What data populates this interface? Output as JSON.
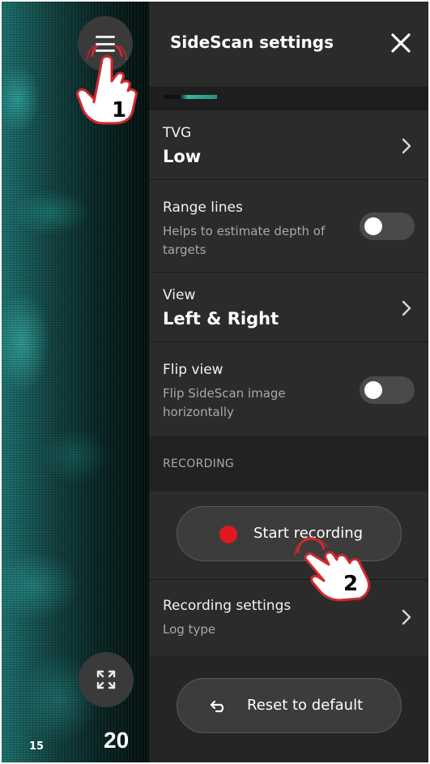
{
  "map": {
    "menu_icon": "hamburger-menu-icon",
    "expand_icon": "expand-arrows-icon",
    "scale_small": "15",
    "scale_large": "20"
  },
  "annotations": {
    "step1": "1",
    "step2": "2"
  },
  "panel": {
    "title": "SideScan settings",
    "close_icon": "close-x-icon",
    "tvg": {
      "label": "TVG",
      "value": "Low"
    },
    "range_lines": {
      "label": "Range lines",
      "description": "Helps to estimate depth of targets",
      "enabled": false
    },
    "view": {
      "label": "View",
      "value": "Left & Right"
    },
    "flip_view": {
      "label": "Flip view",
      "description": "Flip SideScan image horizontally",
      "enabled": false
    },
    "recording_section": "RECORDING",
    "start_recording": "Start recording",
    "recording_settings": {
      "label": "Recording settings",
      "description": "Log type"
    },
    "reset_button": "Reset to default"
  },
  "colors": {
    "panel_bg": "#252525",
    "row_bg": "#2b2b2b",
    "record_red": "#e0191e",
    "sonar_teal": "#2fb7a3",
    "annotation_red": "#d0282f"
  }
}
